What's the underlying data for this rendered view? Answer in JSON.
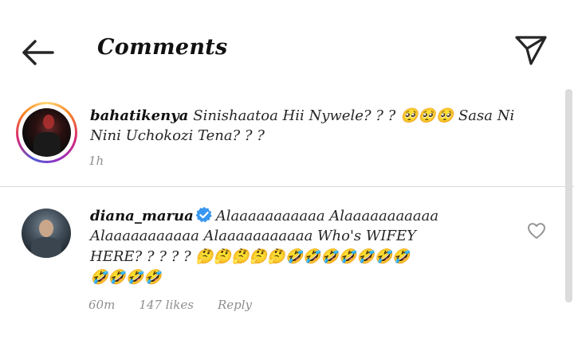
{
  "header": {
    "title": "Comments",
    "back_icon": "arrow-left-icon",
    "share_icon": "paper-plane-icon"
  },
  "caption": {
    "username": "bahatikenya",
    "line1": "Sinishaatoa Hii Nywele? ? ?  🥺🥺🥺  Sasa Ni",
    "line2": "Nini Uchokozi Tena? ? ?",
    "time": "1h"
  },
  "comments": [
    {
      "username": "diana_marua",
      "verified": true,
      "line1": "Alaaaaaaaaaaa Alaaaaaaaaaaa",
      "line2": "Alaaaaaaaaaaa Alaaaaaaaaaaa  Who's WIFEY",
      "line3": "HERE? ? ? ? ?  🤔🤔🤔🤔🤔🤣🤣🤣🤣🤣🤣🤣",
      "line4": "🤣🤣🤣🤣",
      "time": "60m",
      "likes": "147 likes",
      "reply": "Reply"
    }
  ],
  "colors": {
    "text": "#262626",
    "muted": "#8e8e8e",
    "verified": "#3897f0",
    "divider": "#dbdbdb"
  }
}
